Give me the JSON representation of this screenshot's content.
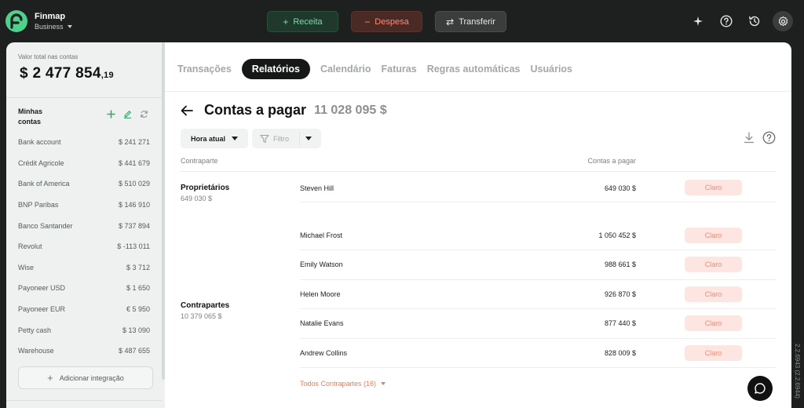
{
  "app": {
    "name": "Finmap",
    "plan": "Business"
  },
  "topbar": {
    "income_label": "Receita",
    "expense_label": "Despesa",
    "transfer_label": "Transferir"
  },
  "sidebar": {
    "total_label": "Valor total nas contas",
    "total_currency": "$",
    "total_int": "2 477 854",
    "total_cents": ",19",
    "accounts_title": "Minhas contas",
    "accounts": [
      {
        "name": "Bank account",
        "amount": "$  241 271"
      },
      {
        "name": "Crédit Agricole",
        "amount": "$  441 679"
      },
      {
        "name": "Bank of America",
        "amount": "$  510 029"
      },
      {
        "name": "BNP Paribas",
        "amount": "$  146 910"
      },
      {
        "name": "Banco Santander",
        "amount": "$  737 894"
      },
      {
        "name": "Revolut",
        "amount": "$  -113 011"
      },
      {
        "name": "Wise",
        "amount": "$  3 712"
      },
      {
        "name": "Payoneer USD",
        "amount": "$  1 650"
      },
      {
        "name": "Payoneer EUR",
        "amount": "€  5 950"
      },
      {
        "name": "Petty cash",
        "amount": "$  13 090"
      },
      {
        "name": "Warehouse",
        "amount": "$  487 655"
      }
    ],
    "add_integration": "Adicionar integração"
  },
  "tabs": [
    {
      "label": "Transações",
      "active": false
    },
    {
      "label": "Relatórios",
      "active": true
    },
    {
      "label": "Calendário",
      "active": false
    },
    {
      "label": "Faturas",
      "active": false
    },
    {
      "label": "Regras automáticas",
      "active": false
    },
    {
      "label": "Usuários",
      "active": false
    }
  ],
  "report": {
    "title": "Contas a pagar",
    "total": "11 028 095  $",
    "period": "Hora atual",
    "filter": "Filtro",
    "col_counterparty": "Contraparte",
    "col_payable": "Contas a pagar",
    "groups": [
      {
        "title": "Proprietários",
        "subtotal": "649 030  $",
        "rows": [
          {
            "name": "Steven Hill",
            "amount": "649 030  $",
            "badge": "Claro"
          }
        ]
      },
      {
        "title": "Contrapartes",
        "subtotal": "10 379 065  $",
        "rows": [
          {
            "name": "Michael Frost",
            "amount": "1 050 452  $",
            "badge": "Claro"
          },
          {
            "name": "Emily Watson",
            "amount": "988 661  $",
            "badge": "Claro"
          },
          {
            "name": "Helen Moore",
            "amount": "926 870  $",
            "badge": "Claro"
          },
          {
            "name": "Natalie Evans",
            "amount": "877 440  $",
            "badge": "Claro"
          },
          {
            "name": "Andrew Collins",
            "amount": "828 009  $",
            "badge": "Claro"
          }
        ]
      }
    ],
    "more_link": "Todos Contrapartes (16)"
  },
  "version": "2.2.6943 (2.2.6944)",
  "colors": {
    "accent_green": "#7fd8a6",
    "accent_red": "#ff8a73",
    "link_orange": "#f07a52",
    "badge_bg": "#fde6e1"
  },
  "icons": {
    "logo": "finmap-logo-icon",
    "magic": "sparkle-icon",
    "help": "question-circle-icon",
    "history": "history-icon",
    "settings": "gear-icon",
    "back": "arrow-left-icon",
    "download": "download-icon",
    "filter": "funnel-icon",
    "chat": "chat-bubble-icon"
  }
}
